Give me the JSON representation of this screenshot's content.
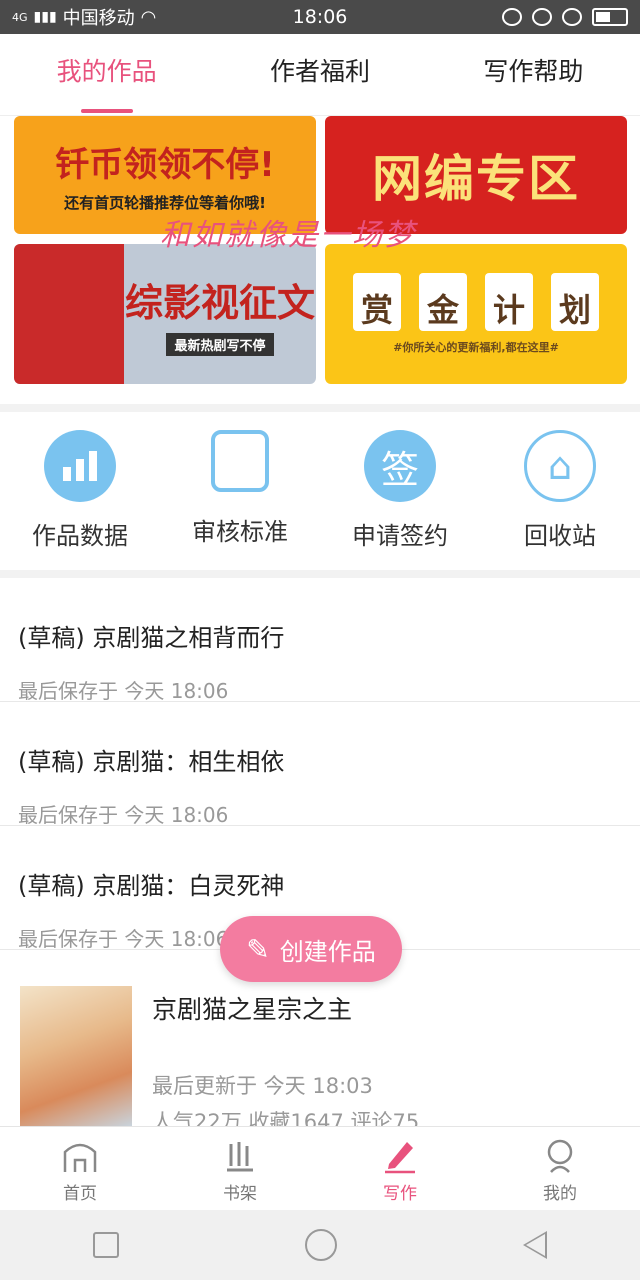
{
  "status_bar": {
    "carrier": "中国移动",
    "network": "4G",
    "time": "18:06"
  },
  "top_tabs": [
    {
      "label": "我的作品",
      "active": true
    },
    {
      "label": "作者福利",
      "active": false
    },
    {
      "label": "写作帮助",
      "active": false
    }
  ],
  "banners": {
    "b1_big": "钎币领领不停!",
    "b1_small": "还有首页轮播推荐位等着你哦!",
    "b2_big": "网编专区",
    "b3_big": "综影视征文",
    "b3_small": "最新热剧写不停",
    "b4_chars": [
      "赏",
      "金",
      "计",
      "划"
    ],
    "b4_small": "#你所关心的更新福利,都在这里#",
    "overlay_text": "和如就像是一场梦"
  },
  "quick_actions": [
    {
      "label": "作品数据",
      "icon": "bar-chart-icon"
    },
    {
      "label": "审核标准",
      "icon": "document-check-icon"
    },
    {
      "label": "申请签约",
      "icon": "sign-icon",
      "glyph": "签"
    },
    {
      "label": "回收站",
      "icon": "trash-icon"
    }
  ],
  "drafts": [
    {
      "title": "(草稿) 京剧猫之相背而行",
      "time": "最后保存于 今天 18:06"
    },
    {
      "title": "(草稿) 京剧猫：相生相依",
      "time": "最后保存于 今天 18:06"
    },
    {
      "title": "(草稿) 京剧猫：白灵死神",
      "time": "最后保存于 今天 18:06"
    }
  ],
  "published": {
    "title": "京剧猫之星宗之主",
    "time": "最后更新于 今天 18:03",
    "stats": "人气22万 收藏1647 评论75"
  },
  "fab": {
    "label": "创建作品"
  },
  "bottom_tabs": [
    {
      "label": "首页",
      "icon": "home-icon",
      "active": false
    },
    {
      "label": "书架",
      "icon": "bookshelf-icon",
      "active": false
    },
    {
      "label": "写作",
      "icon": "pen-icon",
      "active": true
    },
    {
      "label": "我的",
      "icon": "profile-icon",
      "active": false
    }
  ],
  "colors": {
    "accent": "#e8527d",
    "icon_blue": "#7ac3ef",
    "fab": "#f37ca0"
  }
}
